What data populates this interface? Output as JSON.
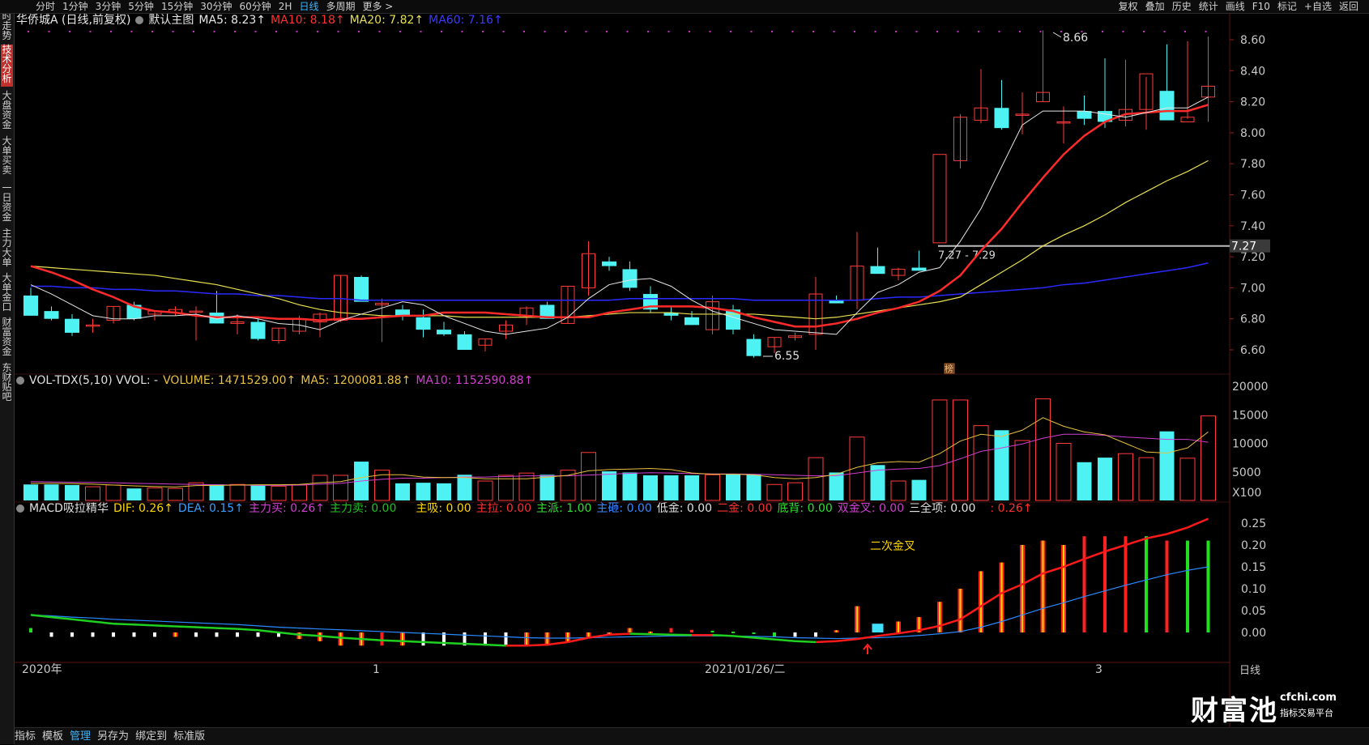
{
  "topbar": {
    "periods": [
      "分时",
      "1分钟",
      "3分钟",
      "5分钟",
      "15分钟",
      "30分钟",
      "60分钟",
      "2H",
      "日线",
      "多周期",
      "更多 >"
    ],
    "active_period": "日线",
    "actions": [
      "复权",
      "叠加",
      "历史",
      "统计",
      "画线",
      "F10",
      "标记",
      "+自选",
      "返回"
    ]
  },
  "sidebar": {
    "tabs": [
      "分时走势",
      "技术分析",
      "大盘资金",
      "大单买卖",
      "一日资金",
      "主力大单",
      "大单金口",
      "财富资金",
      "东财贴吧"
    ],
    "active": "技术分析"
  },
  "main_legend": {
    "stock": "华侨城A (日线,前复权)",
    "template": "默认主图",
    "ma5": "MA5: 8.23↑",
    "ma10": "MA10: 8.18↑",
    "ma20": "MA20: 7.82↑",
    "ma60": "MA60: 7.16↑"
  },
  "price_axis": [
    "8.60",
    "8.40",
    "8.20",
    "8.00",
    "7.80",
    "7.60",
    "7.40",
    "7.20",
    "7.00",
    "6.80",
    "6.60"
  ],
  "price_tag": "7.27",
  "annotations": {
    "high": "8.66",
    "low": "6.55",
    "range": "7.27 - 7.29",
    "badge": "榜",
    "macd_note": "二次金叉"
  },
  "vol_legend": {
    "title": "VOL-TDX(5,10) VVOL: -",
    "volume": "VOLUME: 1471529.00↑",
    "ma5": "MA5: 1200081.88↑",
    "ma10": "MA10: 1152590.88↑"
  },
  "vol_axis": [
    "20000",
    "15000",
    "10000",
    "5000",
    "X100"
  ],
  "macd_legend": {
    "title": "MACD吸拉精华",
    "dif": "DIF: 0.26↑",
    "dea": "DEA: 0.15↑",
    "zlm": "主力买: 0.26↑",
    "zlmc": "主力卖: 0.00",
    "zx": "主吸: 0.00",
    "zl": "主拉: 0.00",
    "zp": "主派: 1.00",
    "zz": "主砸: 0.00",
    "dj": "低金: 0.00",
    "ej": "二金: 0.00",
    "db": "底背: 0.00",
    "sjc": "双金叉: 0.00",
    "sqx": "三全项: 0.00",
    "last": ": 0.26↑"
  },
  "macd_axis": [
    "0.25",
    "0.20",
    "0.15",
    "0.10",
    "0.05",
    "0.00"
  ],
  "date_axis": {
    "left": "2020年",
    "mid1": "1",
    "mid2": "2021/01/26/二",
    "right": "3"
  },
  "axis_period_label": "日线",
  "bottombar": {
    "items": [
      "指标",
      "模板",
      "管理",
      "另存为",
      "绑定到",
      "标准版"
    ],
    "active": "管理"
  },
  "watermark": {
    "brand": "财富池",
    "site": "cfchi.com",
    "slogan": "指标交易平台"
  },
  "colors": {
    "up": "#ff3b3b",
    "down": "#4ef2f2",
    "ma5": "#e6e6e6",
    "ma10": "#ff2a2a",
    "ma20": "#e8e050",
    "ma60": "#2a2aff",
    "vol_ma10": "#d040d0"
  },
  "chart_data": {
    "type": "candlestick",
    "ohlc": [
      [
        6.95,
        7.0,
        6.82,
        6.82
      ],
      [
        6.85,
        6.88,
        6.79,
        6.8
      ],
      [
        6.8,
        6.83,
        6.69,
        6.71
      ],
      [
        6.76,
        6.8,
        6.71,
        6.76
      ],
      [
        6.79,
        6.88,
        6.77,
        6.88
      ],
      [
        6.89,
        6.91,
        6.79,
        6.8
      ],
      [
        6.83,
        6.85,
        6.79,
        6.85
      ],
      [
        6.84,
        6.88,
        6.82,
        6.86
      ],
      [
        6.85,
        6.88,
        6.66,
        6.85
      ],
      [
        6.84,
        6.98,
        6.77,
        6.77
      ],
      [
        6.77,
        6.83,
        6.7,
        6.78
      ],
      [
        6.78,
        6.8,
        6.66,
        6.67
      ],
      [
        6.66,
        6.74,
        6.64,
        6.74
      ],
      [
        6.72,
        6.82,
        6.7,
        6.8
      ],
      [
        6.78,
        6.84,
        6.68,
        6.83
      ],
      [
        6.79,
        7.08,
        6.78,
        7.08
      ],
      [
        7.07,
        7.08,
        6.91,
        6.91
      ],
      [
        6.89,
        6.93,
        6.65,
        6.9
      ],
      [
        6.86,
        6.89,
        6.79,
        6.82
      ],
      [
        6.81,
        6.86,
        6.68,
        6.73
      ],
      [
        6.73,
        6.78,
        6.69,
        6.7
      ],
      [
        6.7,
        6.72,
        6.6,
        6.6
      ],
      [
        6.63,
        6.67,
        6.59,
        6.67
      ],
      [
        6.72,
        6.79,
        6.67,
        6.76
      ],
      [
        6.81,
        6.88,
        6.76,
        6.87
      ],
      [
        6.89,
        6.91,
        6.8,
        6.8
      ],
      [
        6.77,
        7.01,
        6.77,
        7.01
      ],
      [
        7.0,
        7.3,
        6.95,
        7.22
      ],
      [
        7.17,
        7.2,
        7.11,
        7.14
      ],
      [
        7.12,
        7.17,
        6.98,
        7.0
      ],
      [
        6.96,
        7.01,
        6.84,
        6.86
      ],
      [
        6.84,
        6.88,
        6.79,
        6.82
      ],
      [
        6.81,
        6.85,
        6.76,
        6.76
      ],
      [
        6.73,
        6.95,
        6.7,
        6.91
      ],
      [
        6.86,
        6.89,
        6.7,
        6.73
      ],
      [
        6.67,
        6.7,
        6.55,
        6.56
      ],
      [
        6.62,
        6.68,
        6.58,
        6.68
      ],
      [
        6.68,
        6.71,
        6.66,
        6.69
      ],
      [
        6.7,
        7.07,
        6.6,
        6.96
      ],
      [
        6.92,
        6.95,
        6.9,
        6.9
      ],
      [
        6.92,
        7.36,
        6.86,
        7.14
      ],
      [
        7.14,
        7.26,
        7.09,
        7.09
      ],
      [
        7.08,
        7.13,
        7.05,
        7.12
      ],
      [
        7.13,
        7.24,
        7.11,
        7.11
      ],
      [
        7.29,
        7.29,
        7.29,
        7.86
      ],
      [
        7.82,
        8.12,
        7.77,
        8.1
      ],
      [
        8.08,
        8.41,
        8.06,
        8.16
      ],
      [
        8.16,
        8.34,
        8.02,
        8.03
      ],
      [
        8.12,
        8.26,
        7.99,
        8.12
      ],
      [
        8.2,
        8.66,
        8.2,
        8.26
      ],
      [
        8.07,
        8.17,
        7.93,
        8.07
      ],
      [
        8.14,
        8.24,
        8.05,
        8.09
      ],
      [
        8.14,
        8.48,
        8.03,
        8.07
      ],
      [
        8.08,
        8.47,
        8.04,
        8.15
      ],
      [
        8.15,
        8.36,
        8.02,
        8.38
      ],
      [
        8.27,
        8.57,
        8.12,
        8.08
      ],
      [
        8.07,
        8.59,
        8.09,
        8.1
      ],
      [
        8.23,
        8.62,
        8.07,
        8.3
      ]
    ],
    "ma5": [
      7.02,
      6.96,
      6.89,
      6.82,
      6.8,
      6.8,
      6.82,
      6.82,
      6.83,
      6.8,
      6.82,
      6.8,
      6.77,
      6.76,
      6.73,
      6.79,
      6.83,
      6.87,
      6.91,
      6.89,
      6.82,
      6.77,
      6.72,
      6.7,
      6.72,
      6.74,
      6.81,
      6.93,
      7.02,
      7.05,
      7.06,
      7.01,
      6.92,
      6.85,
      6.81,
      6.77,
      6.73,
      6.72,
      6.71,
      6.7,
      6.84,
      6.97,
      7.02,
      7.1,
      7.13,
      7.3,
      7.51,
      7.78,
      8.05,
      8.14,
      8.14,
      8.14,
      8.12,
      8.1,
      8.13,
      8.16,
      8.16,
      8.23
    ],
    "ma10": [
      7.14,
      7.1,
      7.05,
      6.99,
      6.94,
      6.88,
      6.85,
      6.84,
      6.82,
      6.81,
      6.81,
      6.81,
      6.8,
      6.8,
      6.79,
      6.8,
      6.8,
      6.81,
      6.82,
      6.82,
      6.84,
      6.84,
      6.84,
      6.83,
      6.82,
      6.81,
      6.81,
      6.81,
      6.84,
      6.86,
      6.88,
      6.88,
      6.88,
      6.87,
      6.85,
      6.81,
      6.78,
      6.75,
      6.75,
      6.77,
      6.8,
      6.84,
      6.87,
      6.91,
      6.98,
      7.08,
      7.24,
      7.38,
      7.55,
      7.71,
      7.86,
      7.98,
      8.07,
      8.12,
      8.13,
      8.14,
      8.14,
      8.18
    ],
    "ma20": [
      7.14,
      7.13,
      7.12,
      7.11,
      7.1,
      7.09,
      7.08,
      7.06,
      7.04,
      7.02,
      6.99,
      6.96,
      6.93,
      6.89,
      6.86,
      6.84,
      6.83,
      6.82,
      6.82,
      6.82,
      6.82,
      6.81,
      6.81,
      6.81,
      6.81,
      6.81,
      6.81,
      6.82,
      6.83,
      6.84,
      6.84,
      6.84,
      6.83,
      6.83,
      6.83,
      6.83,
      6.82,
      6.81,
      6.8,
      6.81,
      6.83,
      6.85,
      6.87,
      6.89,
      6.91,
      6.94,
      7.02,
      7.1,
      7.18,
      7.27,
      7.34,
      7.4,
      7.47,
      7.55,
      7.62,
      7.69,
      7.75,
      7.82
    ],
    "ma60": [
      7.01,
      7.01,
      7.0,
      7.0,
      6.99,
      6.99,
      6.98,
      6.98,
      6.97,
      6.96,
      6.96,
      6.95,
      6.95,
      6.94,
      6.93,
      6.93,
      6.92,
      6.92,
      6.92,
      6.92,
      6.92,
      6.92,
      6.92,
      6.92,
      6.92,
      6.92,
      6.92,
      6.92,
      6.92,
      6.93,
      6.93,
      6.93,
      6.93,
      6.93,
      6.93,
      6.92,
      6.92,
      6.92,
      6.92,
      6.92,
      6.92,
      6.93,
      6.94,
      6.94,
      6.95,
      6.96,
      6.97,
      6.98,
      6.99,
      7.0,
      7.02,
      7.03,
      7.05,
      7.07,
      7.09,
      7.11,
      7.13,
      7.16
    ],
    "volume": [
      2800,
      2800,
      2700,
      2400,
      2700,
      2100,
      2200,
      2100,
      3100,
      2800,
      2800,
      2700,
      2500,
      2700,
      4400,
      4400,
      6800,
      5300,
      3000,
      3100,
      3000,
      4500,
      3400,
      4400,
      4800,
      4500,
      5300,
      8400,
      5100,
      4900,
      4400,
      4400,
      4400,
      4500,
      4600,
      4600,
      2800,
      3100,
      7500,
      4900,
      11100,
      6200,
      3400,
      3600,
      17600,
      17600,
      13100,
      12300,
      10500,
      17800,
      10000,
      6700,
      7500,
      8200,
      7500,
      12100,
      7400,
      14800
    ],
    "vol_ma5": [
      3000,
      3000,
      2950,
      2850,
      2700,
      2550,
      2450,
      2350,
      2600,
      2650,
      2700,
      2750,
      2750,
      2800,
      3100,
      3300,
      4000,
      4500,
      4500,
      4100,
      4000,
      4000,
      3800,
      3800,
      3800,
      4100,
      4400,
      5200,
      5400,
      5500,
      5600,
      5400,
      4800,
      4600,
      4600,
      4500,
      4000,
      3800,
      4000,
      4600,
      5800,
      6600,
      6800,
      6700,
      8200,
      10400,
      11600,
      11200,
      12300,
      14500,
      13000,
      12000,
      11500,
      10000,
      8500,
      8300,
      9200,
      12000
    ],
    "vol_ma10": [
      3300,
      3250,
      3200,
      3150,
      3100,
      3000,
      2950,
      2850,
      2800,
      2750,
      2700,
      2650,
      2650,
      2700,
      2850,
      3000,
      3400,
      3700,
      3900,
      3900,
      4000,
      4100,
      4100,
      4200,
      4300,
      4300,
      4300,
      4450,
      4600,
      4750,
      4850,
      4800,
      4700,
      4650,
      4650,
      4600,
      4500,
      4400,
      4300,
      4350,
      4800,
      5300,
      5500,
      5600,
      6100,
      7300,
      8600,
      9200,
      9900,
      10900,
      11600,
      11600,
      11400,
      11100,
      10900,
      10700,
      10700,
      10200
    ],
    "macd_dif": [
      0.04,
      0.035,
      0.03,
      0.025,
      0.02,
      0.018,
      0.016,
      0.014,
      0.012,
      0.01,
      0.008,
      0.005,
      0.0,
      -0.005,
      -0.008,
      -0.012,
      -0.015,
      -0.018,
      -0.02,
      -0.022,
      -0.024,
      -0.026,
      -0.028,
      -0.03,
      -0.03,
      -0.028,
      -0.022,
      -0.012,
      -0.005,
      -0.003,
      -0.004,
      -0.005,
      -0.006,
      -0.006,
      -0.008,
      -0.012,
      -0.016,
      -0.02,
      -0.022,
      -0.02,
      -0.015,
      -0.008,
      -0.002,
      0.005,
      0.015,
      0.03,
      0.06,
      0.09,
      0.11,
      0.135,
      0.15,
      0.168,
      0.185,
      0.2,
      0.215,
      0.225,
      0.24,
      0.26
    ],
    "macd_dea": [
      0.04,
      0.038,
      0.035,
      0.033,
      0.03,
      0.028,
      0.026,
      0.024,
      0.022,
      0.02,
      0.018,
      0.015,
      0.012,
      0.01,
      0.008,
      0.006,
      0.004,
      0.002,
      0.0,
      -0.002,
      -0.004,
      -0.006,
      -0.008,
      -0.01,
      -0.012,
      -0.013,
      -0.013,
      -0.012,
      -0.011,
      -0.01,
      -0.009,
      -0.008,
      -0.008,
      -0.008,
      -0.008,
      -0.009,
      -0.01,
      -0.012,
      -0.013,
      -0.014,
      -0.013,
      -0.012,
      -0.01,
      -0.007,
      -0.003,
      0.002,
      0.012,
      0.025,
      0.04,
      0.055,
      0.068,
      0.082,
      0.095,
      0.108,
      0.12,
      0.132,
      0.142,
      0.15
    ],
    "macd_hist": [
      0.01,
      -0.01,
      -0.01,
      -0.01,
      -0.01,
      -0.01,
      -0.01,
      -0.01,
      -0.01,
      -0.01,
      -0.01,
      -0.01,
      -0.01,
      -0.015,
      -0.02,
      -0.03,
      -0.03,
      -0.03,
      -0.03,
      -0.03,
      -0.03,
      -0.03,
      -0.03,
      -0.03,
      -0.03,
      -0.03,
      -0.02,
      -0.01,
      -0.003,
      0.01,
      0.002,
      0.01,
      0.006,
      0.004,
      0.002,
      -0.002,
      -0.01,
      -0.01,
      -0.01,
      0.005,
      0.06,
      0.02,
      0.025,
      0.035,
      0.07,
      0.1,
      0.14,
      0.16,
      0.2,
      0.21,
      0.2,
      0.22,
      0.22,
      0.22,
      0.22,
      0.21,
      0.21,
      0.21
    ],
    "macd_hist_kind": [
      "g",
      "w",
      "w",
      "w",
      "w",
      "w",
      "w",
      "y",
      "w",
      "w",
      "w",
      "w",
      "w",
      "y",
      "y",
      "y",
      "y",
      "r",
      "y",
      "w",
      "w",
      "w",
      "w",
      "w",
      "y",
      "y",
      "y",
      "y",
      "y",
      "y",
      "y",
      "r",
      "r",
      "g",
      "g",
      "g",
      "g",
      "w",
      "w",
      "y",
      "y",
      "b",
      "y",
      "y",
      "y",
      "y",
      "y",
      "y",
      "y",
      "y",
      "y",
      "r",
      "r",
      "r",
      "g",
      "r",
      "g",
      "g"
    ]
  }
}
